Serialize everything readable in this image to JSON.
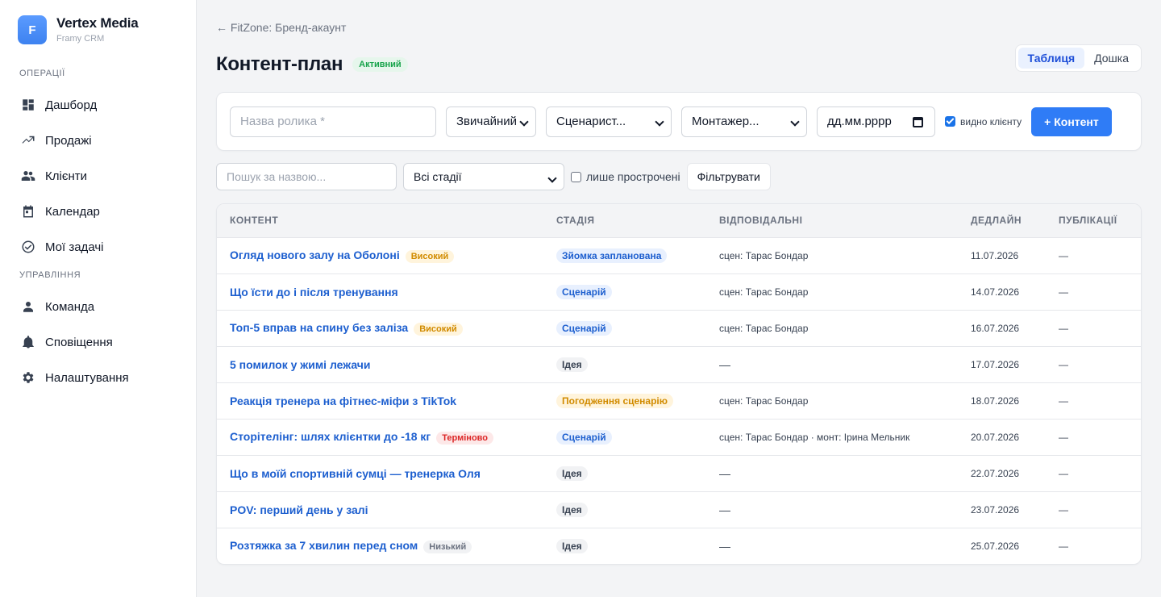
{
  "brand": {
    "logo_letter": "F",
    "name": "Vertex Media",
    "sub": "Framy CRM"
  },
  "sidebar": {
    "sections": [
      {
        "title": "ОПЕРАЦІЇ",
        "items": [
          {
            "label": "Дашборд",
            "icon": "dashboard-icon"
          },
          {
            "label": "Продажі",
            "icon": "trending-up-icon"
          },
          {
            "label": "Клієнти",
            "icon": "people-icon"
          },
          {
            "label": "Календар",
            "icon": "calendar-icon"
          },
          {
            "label": "Мої задачі",
            "icon": "check-circle-icon"
          }
        ]
      },
      {
        "title": "УПРАВЛІННЯ",
        "items": [
          {
            "label": "Команда",
            "icon": "person-icon"
          },
          {
            "label": "Сповіщення",
            "icon": "bell-icon"
          },
          {
            "label": "Налаштування",
            "icon": "gear-icon"
          }
        ]
      }
    ]
  },
  "header": {
    "back": "← FitZone: Бренд-акаунт",
    "title": "Контент-план",
    "status": "Активний",
    "views": {
      "table": "Таблиця",
      "board": "Дошка"
    }
  },
  "create_form": {
    "title_placeholder": "Назва ролика *",
    "format": "Звичайний",
    "scriptwriter": "Сценарист...",
    "editor": "Монтажер...",
    "date_placeholder": "дд.мм.рррр",
    "client_visible": "видно клієнту",
    "add_button": "+ Контент"
  },
  "filters": {
    "search_placeholder": "Пошук за назвою...",
    "stage": "Всі стадії",
    "overdue_label": "лише прострочені",
    "apply": "Фільтрувати"
  },
  "table": {
    "columns": [
      "КОНТЕНТ",
      "СТАДІЯ",
      "ВІДПОВІДАЛЬНІ",
      "ДЕДЛАЙН",
      "ПУБЛІКАЦІЇ"
    ],
    "rows": [
      {
        "title": "Огляд нового залу на Оболоні",
        "priority": "Високий",
        "stage": "Зйомка запланована",
        "responsible": "сцен: Тарас Бондар",
        "deadline": "11.07.2026",
        "publications": "—"
      },
      {
        "title": "Що їсти до і після тренування",
        "priority": "",
        "stage": "Сценарій",
        "responsible": "сцен: Тарас Бондар",
        "deadline": "14.07.2026",
        "publications": "—"
      },
      {
        "title": "Топ-5 вправ на спину без заліза",
        "priority": "Високий",
        "stage": "Сценарій",
        "responsible": "сцен: Тарас Бондар",
        "deadline": "16.07.2026",
        "publications": "—"
      },
      {
        "title": "5 помилок у жимі лежачи",
        "priority": "",
        "stage": "Ідея",
        "responsible": "—",
        "deadline": "17.07.2026",
        "publications": "—"
      },
      {
        "title": "Реакція тренера на фітнес-міфи з TikTok",
        "priority": "",
        "stage": "Погодження сценарію",
        "responsible": "сцен: Тарас Бондар",
        "deadline": "18.07.2026",
        "publications": "—"
      },
      {
        "title": "Сторітелінг: шлях клієнтки до -18 кг",
        "priority": "Терміново",
        "stage": "Сценарій",
        "responsible": "сцен: Тарас Бондар · монт: Ірина Мельник",
        "deadline": "20.07.2026",
        "publications": "—"
      },
      {
        "title": "Що в моїй спортивній сумці — тренерка Оля",
        "priority": "",
        "stage": "Ідея",
        "responsible": "—",
        "deadline": "22.07.2026",
        "publications": "—"
      },
      {
        "title": "POV: перший день у залі",
        "priority": "",
        "stage": "Ідея",
        "responsible": "—",
        "deadline": "23.07.2026",
        "publications": "—"
      },
      {
        "title": "Розтяжка за 7 хвилин перед сном",
        "priority": "Низький",
        "stage": "Ідея",
        "responsible": "—",
        "deadline": "25.07.2026",
        "publications": "—"
      }
    ]
  },
  "colors": {
    "accent": "#2f7cf6",
    "link": "#1d5fcf",
    "priority": {
      "Високий": {
        "bg": "#fff4dc",
        "fg": "#d18b00"
      },
      "Терміново": {
        "bg": "#fde8e8",
        "fg": "#dc2626"
      },
      "Низький": {
        "bg": "#f1f2f4",
        "fg": "#6b7280"
      }
    },
    "stage": {
      "Зйомка запланована": {
        "bg": "#e8f0fe",
        "fg": "#1d5fcf"
      },
      "Сценарій": {
        "bg": "#e8f0fe",
        "fg": "#1d5fcf"
      },
      "Ідея": {
        "bg": "#f1f2f4",
        "fg": "#374151"
      },
      "Погодження сценарію": {
        "bg": "#fff4dc",
        "fg": "#d18b00"
      }
    }
  }
}
